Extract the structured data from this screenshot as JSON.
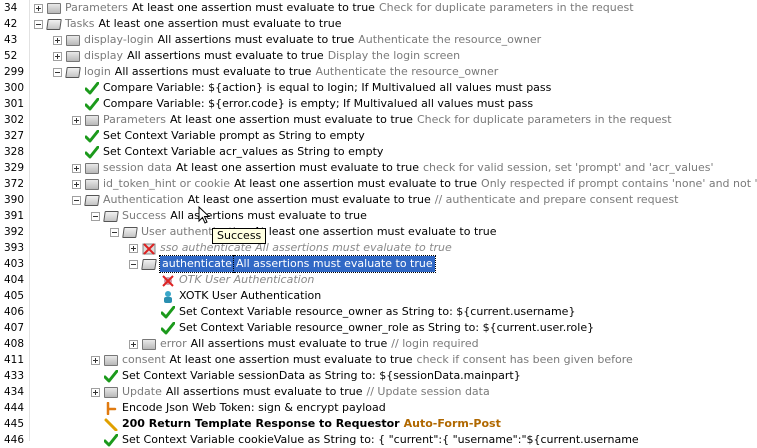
{
  "tooltip": "Success",
  "rows": [
    {
      "ln": "34",
      "indent": 0,
      "tog": "plus",
      "icon": "folder",
      "text": "Parameters",
      "text_grey": true,
      "desc": "At least one assertion must evaluate to true",
      "comment": "Check for duplicate parameters in the request"
    },
    {
      "ln": "42",
      "indent": 0,
      "tog": "minus",
      "icon": "folder-open",
      "text": "Tasks",
      "text_grey": true,
      "desc": "At least one assertion must evaluate to true",
      "comment": ""
    },
    {
      "ln": "43",
      "indent": 1,
      "tog": "plus",
      "icon": "folder",
      "text": "display-login",
      "text_grey": true,
      "desc": "All assertions must evaluate to true",
      "comment": "Authenticate the resource_owner"
    },
    {
      "ln": "52",
      "indent": 1,
      "tog": "plus",
      "icon": "folder",
      "text": "display",
      "text_grey": true,
      "desc": "All assertions must evaluate to true",
      "comment": "Display the login screen"
    },
    {
      "ln": "299",
      "indent": 1,
      "tog": "minus",
      "icon": "folder-open",
      "text": "login",
      "text_grey": true,
      "desc": "All assertions must evaluate to true",
      "comment": "Authenticate the resource_owner"
    },
    {
      "ln": "300",
      "indent": 2,
      "tog": "none",
      "icon": "check",
      "text": "Compare Variable: ${action} is equal to login; If Multivalued all values must pass",
      "text_grey": false,
      "desc": "",
      "comment": ""
    },
    {
      "ln": "301",
      "indent": 2,
      "tog": "none",
      "icon": "check",
      "text": "Compare Variable: ${error.code} is empty; If Multivalued all values must pass",
      "text_grey": false,
      "desc": "",
      "comment": ""
    },
    {
      "ln": "302",
      "indent": 2,
      "tog": "plus",
      "icon": "folder",
      "text": "Parameters",
      "text_grey": true,
      "desc": "At least one assertion must evaluate to true",
      "comment": "Check for duplicate parameters in the request"
    },
    {
      "ln": "327",
      "indent": 2,
      "tog": "none",
      "icon": "check",
      "text": "Set Context Variable prompt as String to empty",
      "text_grey": false,
      "desc": "",
      "comment": ""
    },
    {
      "ln": "328",
      "indent": 2,
      "tog": "none",
      "icon": "check",
      "text": "Set Context Variable acr_values as String to empty",
      "text_grey": false,
      "desc": "",
      "comment": ""
    },
    {
      "ln": "329",
      "indent": 2,
      "tog": "plus",
      "icon": "folder",
      "text": "session data",
      "text_grey": true,
      "desc": "At least one assertion must evaluate to true",
      "comment": "check for valid session, set 'prompt' and 'acr_values'"
    },
    {
      "ln": "372",
      "indent": 2,
      "tog": "plus",
      "icon": "folder",
      "text": "id_token_hint or cookie",
      "text_grey": true,
      "desc": "At least one assertion must evaluate to true",
      "comment": "Only respected if prompt contains 'none' and not 'login'"
    },
    {
      "ln": "390",
      "indent": 2,
      "tog": "minus",
      "icon": "folder-open",
      "text": "Authentication",
      "text_grey": true,
      "desc": "At least one assertion must evaluate to true",
      "comment": "// authenticate and prepare consent request"
    },
    {
      "ln": "391",
      "indent": 3,
      "tog": "minus",
      "icon": "folder-open",
      "text": "Success",
      "text_grey": true,
      "desc": "All assertions must evaluate to true",
      "comment": ""
    },
    {
      "ln": "392",
      "indent": 4,
      "tog": "minus",
      "icon": "folder-open",
      "text": "User authentication",
      "text_grey": true,
      "desc": "At least one assertion must evaluate to true",
      "comment": ""
    },
    {
      "ln": "393",
      "indent": 5,
      "tog": "plus",
      "icon": "disabled",
      "text": "sso authenticate All assertions must evaluate to true",
      "text_grey": false,
      "italic": true,
      "desc": "",
      "comment": ""
    },
    {
      "ln": "403",
      "indent": 5,
      "tog": "minus",
      "icon": "folder-open",
      "text": "authenticate",
      "selected": true,
      "desc": "All assertions must evaluate to true",
      "comment": ""
    },
    {
      "ln": "404",
      "indent": 6,
      "tog": "none",
      "icon": "disabled-x",
      "text": "OTK User Authentication",
      "text_grey": false,
      "italic": true,
      "desc": "",
      "comment": ""
    },
    {
      "ln": "405",
      "indent": 6,
      "tog": "none",
      "icon": "user",
      "text": "XOTK User Authentication",
      "text_grey": false,
      "desc": "",
      "comment": ""
    },
    {
      "ln": "406",
      "indent": 6,
      "tog": "none",
      "icon": "check",
      "text": "Set Context Variable resource_owner as String to: ${current.username}",
      "text_grey": false,
      "desc": "",
      "comment": ""
    },
    {
      "ln": "407",
      "indent": 6,
      "tog": "none",
      "icon": "check",
      "text": "Set Context Variable resource_owner_role as String to: ${current.user.role}",
      "text_grey": false,
      "desc": "",
      "comment": ""
    },
    {
      "ln": "408",
      "indent": 5,
      "tog": "plus",
      "icon": "folder",
      "text": "error",
      "text_grey": true,
      "desc": "All assertions must evaluate to true",
      "comment": "// login required"
    },
    {
      "ln": "411",
      "indent": 3,
      "tog": "plus",
      "icon": "folder",
      "text": "consent",
      "text_grey": true,
      "desc": "At least one assertion must evaluate to true",
      "comment": "check if consent has been given before"
    },
    {
      "ln": "433",
      "indent": 3,
      "tog": "none",
      "icon": "check",
      "text": "Set Context Variable sessionData as String to: ${sessionData.mainpart}",
      "text_grey": false,
      "desc": "",
      "comment": ""
    },
    {
      "ln": "434",
      "indent": 3,
      "tog": "plus",
      "icon": "folder",
      "text": "Update",
      "text_grey": true,
      "desc": "All assertions must evaluate to true",
      "comment": "// Update session data"
    },
    {
      "ln": "444",
      "indent": 3,
      "tog": "none",
      "icon": "jwt",
      "text": "Encode Json Web Token: sign & encrypt payload",
      "text_grey": false,
      "desc": "",
      "comment": ""
    },
    {
      "ln": "445",
      "indent": 3,
      "tog": "none",
      "icon": "template",
      "text": "200 Return Template Response to Requestor",
      "text_grey": false,
      "bold": true,
      "desc": "",
      "comment": "Auto-Form-Post",
      "comment_orange": true
    },
    {
      "ln": "446",
      "indent": 3,
      "tog": "none",
      "icon": "check",
      "text": "Set Context Variable cookieValue as String to: {     \"current\":{      \"username\":\"${current.username",
      "text_grey": false,
      "desc": "",
      "comment": ""
    }
  ]
}
